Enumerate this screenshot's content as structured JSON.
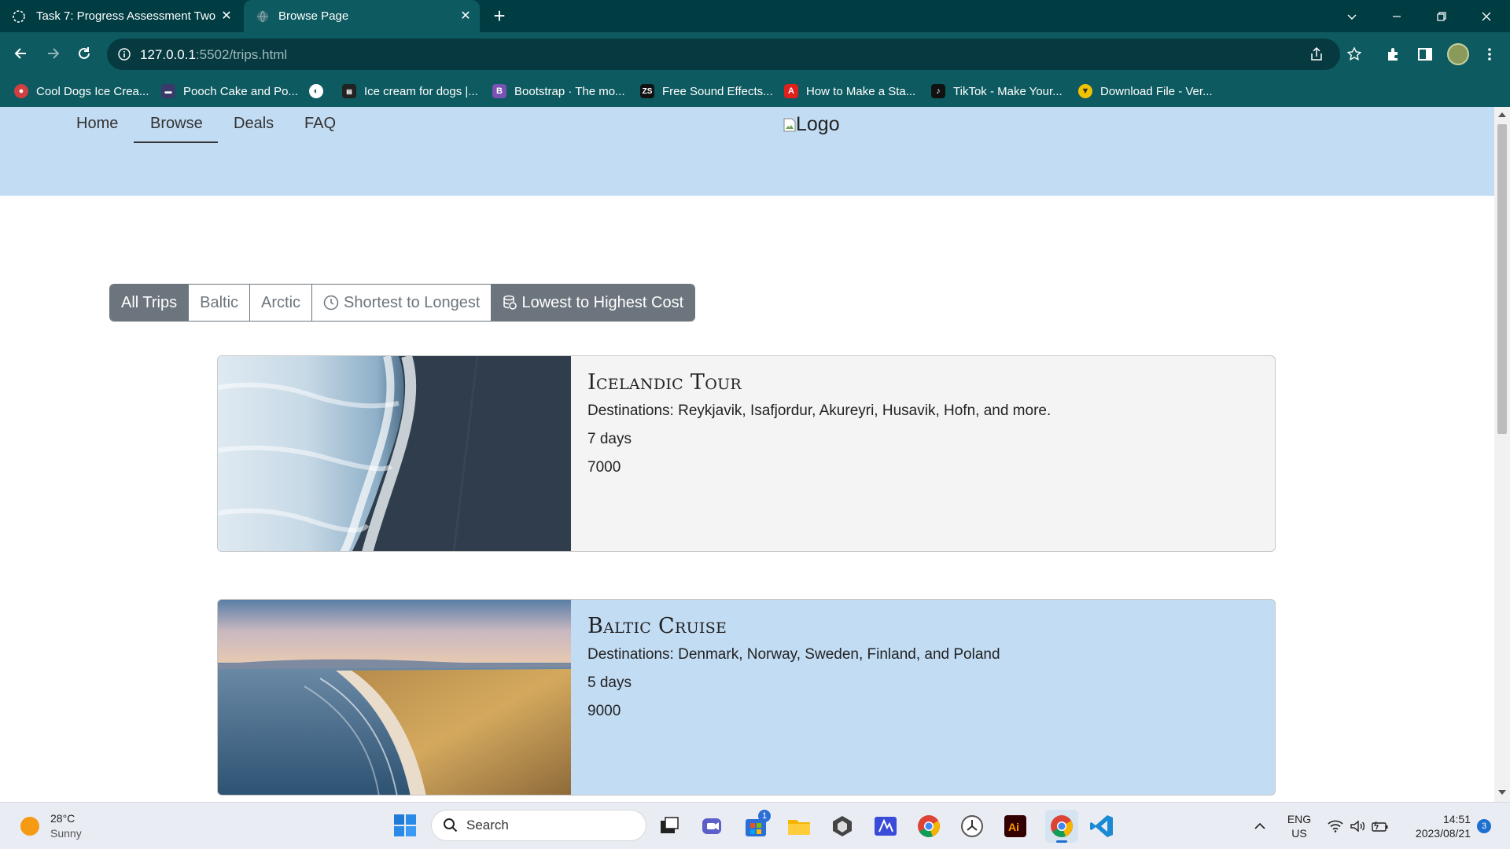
{
  "browser": {
    "tabs": [
      {
        "title": "Task 7: Progress Assessment Two",
        "active": false
      },
      {
        "title": "Browse Page",
        "active": true
      }
    ],
    "new_tab": "+",
    "url_host": "127.0.0.1",
    "url_path": ":5502/trips.html"
  },
  "bookmarks": [
    {
      "label": "Cool Dogs Ice Crea...",
      "icon": "dog-icon",
      "color": "#d04040"
    },
    {
      "label": "Pooch Cake and Po...",
      "icon": "cake-icon",
      "color": "#3a3a6a"
    },
    {
      "label": "",
      "icon": "globe-icon",
      "color": "#0d5a60"
    },
    {
      "label": "Ice cream for dogs |...",
      "icon": "video-icon",
      "color": "#222222"
    },
    {
      "label": "Bootstrap · The mo...",
      "icon": "bootstrap-icon",
      "color": "#7952b3"
    },
    {
      "label": "Free Sound Effects...",
      "icon": "zs-icon",
      "color": "#111111"
    },
    {
      "label": "How to Make a Sta...",
      "icon": "adobe-icon",
      "color": "#e0201a"
    },
    {
      "label": "TikTok - Make Your...",
      "icon": "tiktok-icon",
      "color": "#111111"
    },
    {
      "label": "Download File - Ver...",
      "icon": "download-icon",
      "color": "#f2c200"
    }
  ],
  "site": {
    "nav": [
      {
        "label": "Home"
      },
      {
        "label": "Browse"
      },
      {
        "label": "Deals"
      },
      {
        "label": "FAQ"
      }
    ],
    "logo_alt": "Logo",
    "filters": [
      {
        "label": "All Trips",
        "active": true,
        "icon": ""
      },
      {
        "label": "Baltic",
        "active": false,
        "icon": ""
      },
      {
        "label": "Arctic",
        "active": false,
        "icon": ""
      },
      {
        "label": "Shortest to Longest",
        "active": false,
        "icon": "clock-icon"
      },
      {
        "label": "Lowest to Highest Cost",
        "active": true,
        "icon": "coins-icon"
      }
    ],
    "trips": [
      {
        "title": "Icelandic Tour",
        "destinations": "Destinations: Reykjavik, Isafjordur, Akureyri, Husavik, Hofn, and more.",
        "duration": "7 days",
        "cost": "7000",
        "bg": "#f4f4f4"
      },
      {
        "title": "Baltic Cruise",
        "destinations": "Destinations: Denmark, Norway, Sweden, Finland, and Poland",
        "duration": "5 days",
        "cost": "9000",
        "bg": "#c2dcf3"
      }
    ]
  },
  "taskbar": {
    "temp": "28°C",
    "condition": "Sunny",
    "search": "Search",
    "lang1": "ENG",
    "lang2": "US",
    "time": "14:51",
    "date": "2023/08/21",
    "notifications": "3",
    "store_badge": "1"
  }
}
